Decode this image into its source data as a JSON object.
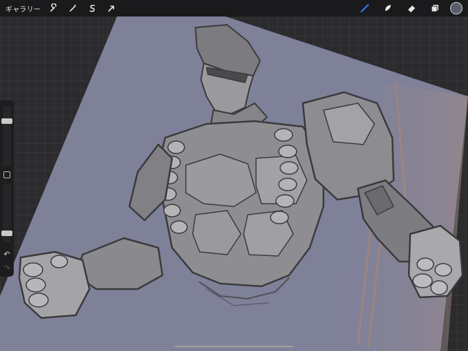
{
  "toolbar": {
    "gallery_label": "ギャラリー",
    "left_tools": [
      {
        "name": "actions",
        "icon": "wrench-icon"
      },
      {
        "name": "adjustments",
        "icon": "magic-wand-icon"
      },
      {
        "name": "selection",
        "icon": "selection-s-icon"
      },
      {
        "name": "transform",
        "icon": "arrow-cursor-icon"
      }
    ],
    "right_tools": [
      {
        "name": "brush",
        "icon": "brush-icon",
        "active": true
      },
      {
        "name": "smudge",
        "icon": "smudge-icon"
      },
      {
        "name": "eraser",
        "icon": "eraser-icon"
      },
      {
        "name": "layers",
        "icon": "layers-icon"
      }
    ],
    "current_color": "#5a5e6a",
    "active_tool_color": "#2f7bff"
  },
  "sidebar": {
    "brush_size_level": 0.22,
    "opacity_level": 0.88,
    "undo_icon": "undo-icon",
    "redo_icon": "redo-icon"
  },
  "canvas": {
    "background_color": "#7f8199",
    "artwork": "muscular-figure-sketch"
  }
}
